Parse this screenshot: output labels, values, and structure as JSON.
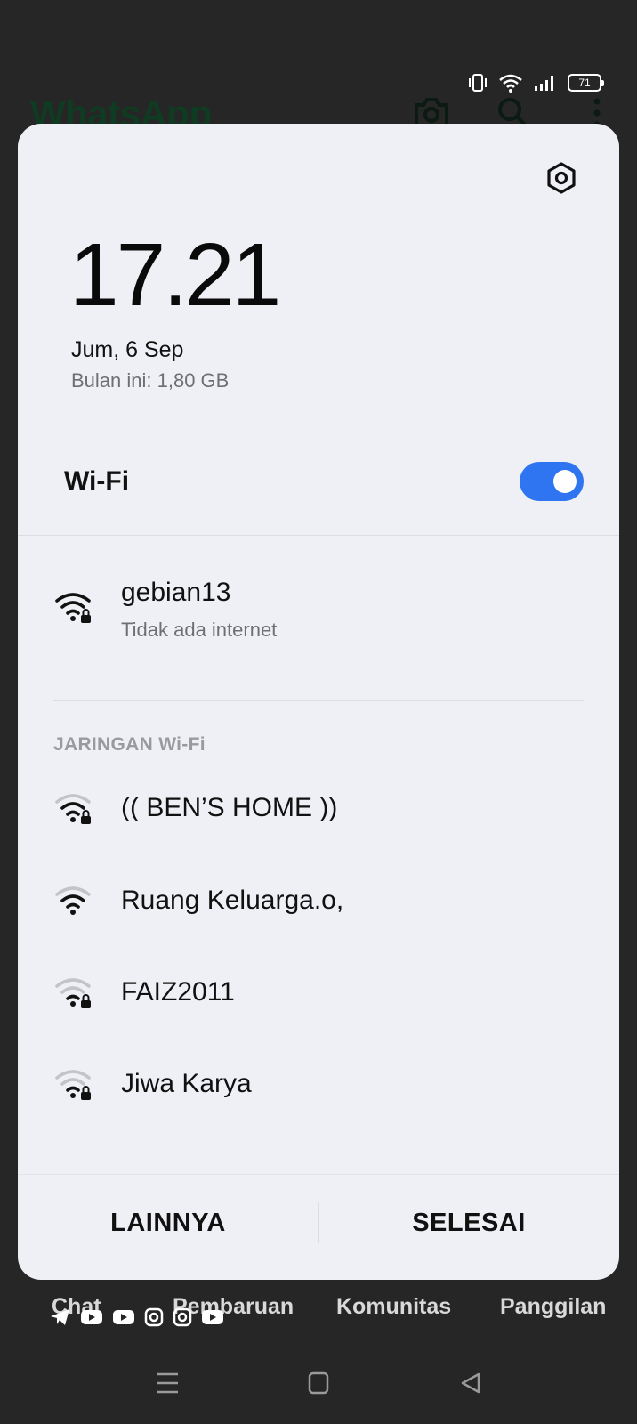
{
  "background_app": {
    "title": "WhatsApp",
    "tabs": [
      "Chat",
      "Pembaruan",
      "Komunitas",
      "Panggilan"
    ],
    "battery_level": "71",
    "social_icons": [
      "telegram-icon",
      "youtube-icon",
      "youtube-icon",
      "instagram-icon",
      "instagram-icon",
      "youtube-icon"
    ]
  },
  "dialog": {
    "time": "17.21",
    "date": "Jum, 6 Sep",
    "data_usage": "Bulan ini: 1,80 GB",
    "wifi_label": "Wi-Fi",
    "wifi_enabled": true,
    "connected_network": {
      "name": "gebian13",
      "status": "Tidak ada internet",
      "icon": "wifi-lock-icon"
    },
    "section_header": "JARINGAN Wi-Fi",
    "networks": [
      {
        "name": "(( BEN’S HOME ))",
        "icon": "wifi-lock-icon"
      },
      {
        "name": "Ruang Keluarga.o,",
        "icon": "wifi-icon"
      },
      {
        "name": "FAIZ2011",
        "icon": "wifi-lock-icon"
      },
      {
        "name": "Jiwa Karya",
        "icon": "wifi-lock-icon"
      }
    ],
    "buttons": {
      "more": "LAINNYA",
      "done": "SELESAI"
    }
  },
  "colors": {
    "accent": "#2f74f0",
    "dialog_bg": "#eff0f5",
    "screen_bg": "#262626"
  }
}
